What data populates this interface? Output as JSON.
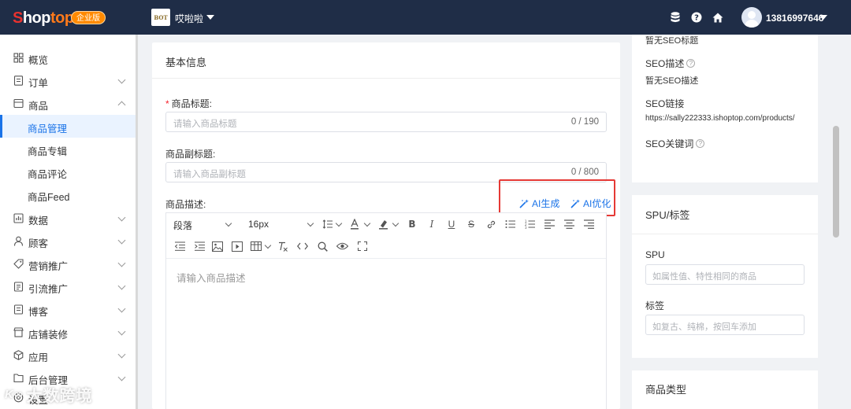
{
  "header": {
    "brand": {
      "s": "S",
      "rest": "hop",
      "accent": "top"
    },
    "edition_badge": "企业版",
    "store_logo_text": "BOT",
    "store_name": "哎啦啦",
    "user_phone": "13816997646"
  },
  "sidebar": {
    "items": [
      {
        "label": "概览",
        "icon": "dashboard-icon"
      },
      {
        "label": "订单",
        "icon": "order-icon"
      },
      {
        "label": "商品",
        "icon": "product-icon"
      },
      {
        "label": "数据",
        "icon": "data-icon"
      },
      {
        "label": "顾客",
        "icon": "customer-icon"
      },
      {
        "label": "营销推广",
        "icon": "marketing-icon"
      },
      {
        "label": "引流推广",
        "icon": "traffic-icon"
      },
      {
        "label": "博客",
        "icon": "blog-icon"
      },
      {
        "label": "店铺装修",
        "icon": "decoration-icon"
      },
      {
        "label": "应用",
        "icon": "app-icon"
      },
      {
        "label": "后台管理",
        "icon": "admin-icon"
      },
      {
        "label": "设置",
        "icon": "settings-icon"
      }
    ],
    "sub_items": [
      {
        "label": "商品管理",
        "active": true
      },
      {
        "label": "商品专辑",
        "active": false
      },
      {
        "label": "商品评论",
        "active": false
      },
      {
        "label": "商品Feed",
        "active": false
      }
    ]
  },
  "main": {
    "section_title": "基本信息",
    "title_field": {
      "label": "商品标题:",
      "placeholder": "请输入商品标题",
      "count": "0 / 190"
    },
    "subtitle_field": {
      "label": "商品副标题:",
      "placeholder": "请输入商品副标题",
      "count": "0 / 800"
    },
    "description": {
      "label": "商品描述:",
      "ai_generate": "AI生成",
      "ai_optimize": "AI优化",
      "paragraph_select": "段落",
      "font_size_select": "16px",
      "placeholder": "请输入商品描述"
    }
  },
  "right_panel": {
    "seo_title_value": "暂无SEO标题",
    "seo_desc_label": "SEO描述",
    "seo_desc_value": "暂无SEO描述",
    "seo_link_label": "SEO链接",
    "seo_link_value": "https://sally222333.ishoptop.com/products/",
    "seo_keywords_label": "SEO关键词",
    "spu_section_title": "SPU/标签",
    "spu_label": "SPU",
    "spu_placeholder": "如属性值、特性相同的商品",
    "tags_label": "标签",
    "tags_placeholder": "如复古、纯棉，按回车添加",
    "product_type_title": "商品类型"
  },
  "watermark": {
    "mark": "K∞",
    "text": "大数跨境"
  },
  "colors": {
    "topbar": "#1f2d47",
    "accent": "#1a73e8",
    "badge": "#ff8a00",
    "highlight_border": "#e53935"
  }
}
